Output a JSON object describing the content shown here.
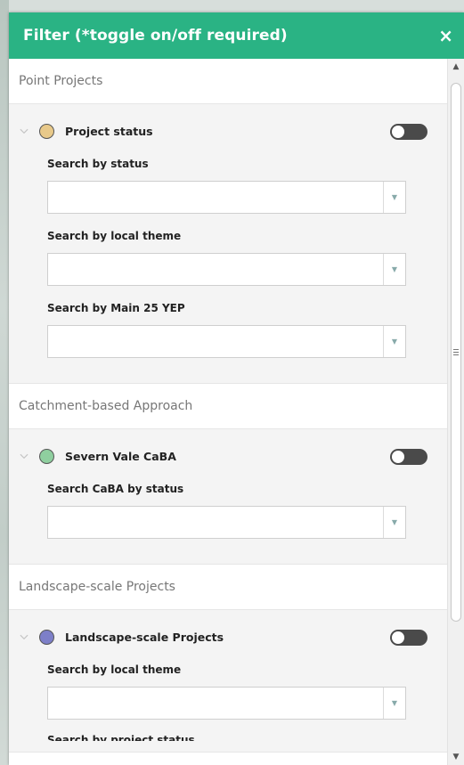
{
  "panel": {
    "title": "Filter (*toggle on/off required)",
    "close_label": "×"
  },
  "colors": {
    "header": "#2ab384",
    "project_status_dot": "#e8c98a",
    "severn_vale_dot": "#8fcf9f",
    "landscape_dot": "#7d7fc8"
  },
  "sections": [
    {
      "title": "Point Projects",
      "layer": {
        "name": "Project status",
        "toggle_on": false,
        "fields": [
          {
            "label": "Search by status",
            "value": ""
          },
          {
            "label": "Search by local theme",
            "value": ""
          },
          {
            "label": "Search by Main 25 YEP",
            "value": ""
          }
        ]
      }
    },
    {
      "title": "Catchment-based Approach",
      "layer": {
        "name": "Severn Vale CaBA",
        "toggle_on": false,
        "fields": [
          {
            "label": "Search CaBA by status",
            "value": ""
          }
        ]
      }
    },
    {
      "title": "Landscape-scale Projects",
      "layer": {
        "name": "Landscape-scale Projects",
        "toggle_on": false,
        "fields": [
          {
            "label": "Search by local theme",
            "value": ""
          },
          {
            "label": "Search by project status",
            "value": ""
          }
        ]
      }
    }
  ]
}
